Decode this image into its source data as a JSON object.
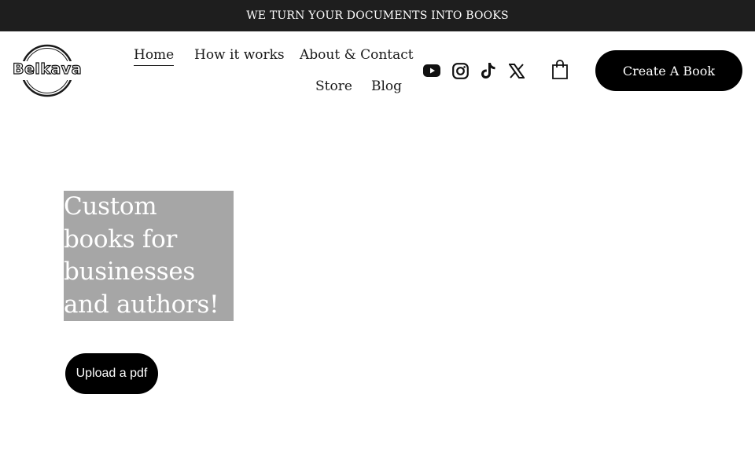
{
  "announcement": {
    "text": "WE TURN YOUR DOCUMENTS INTO BOOKS"
  },
  "brand": {
    "logo_text": "Belkava"
  },
  "nav": {
    "items": [
      {
        "label": "Home",
        "active": true
      },
      {
        "label": "How it works"
      },
      {
        "label": "About & Contact"
      },
      {
        "label": "Store"
      },
      {
        "label": "Blog"
      }
    ]
  },
  "social": {
    "icons": [
      "youtube-icon",
      "instagram-icon",
      "tiktok-icon",
      "x-icon"
    ]
  },
  "cart": {
    "icon": "shopping-bag-icon"
  },
  "header": {
    "cta_label": "Create A Book"
  },
  "hero": {
    "headline": "Custom books for businesses and authors!",
    "cta_label": "Upload a pdf"
  },
  "colors": {
    "announcement_bg": "#1e1e1e",
    "button_bg": "#000000",
    "hero_box_bg": "#a6a6a6",
    "text": "#1a1a1a"
  }
}
